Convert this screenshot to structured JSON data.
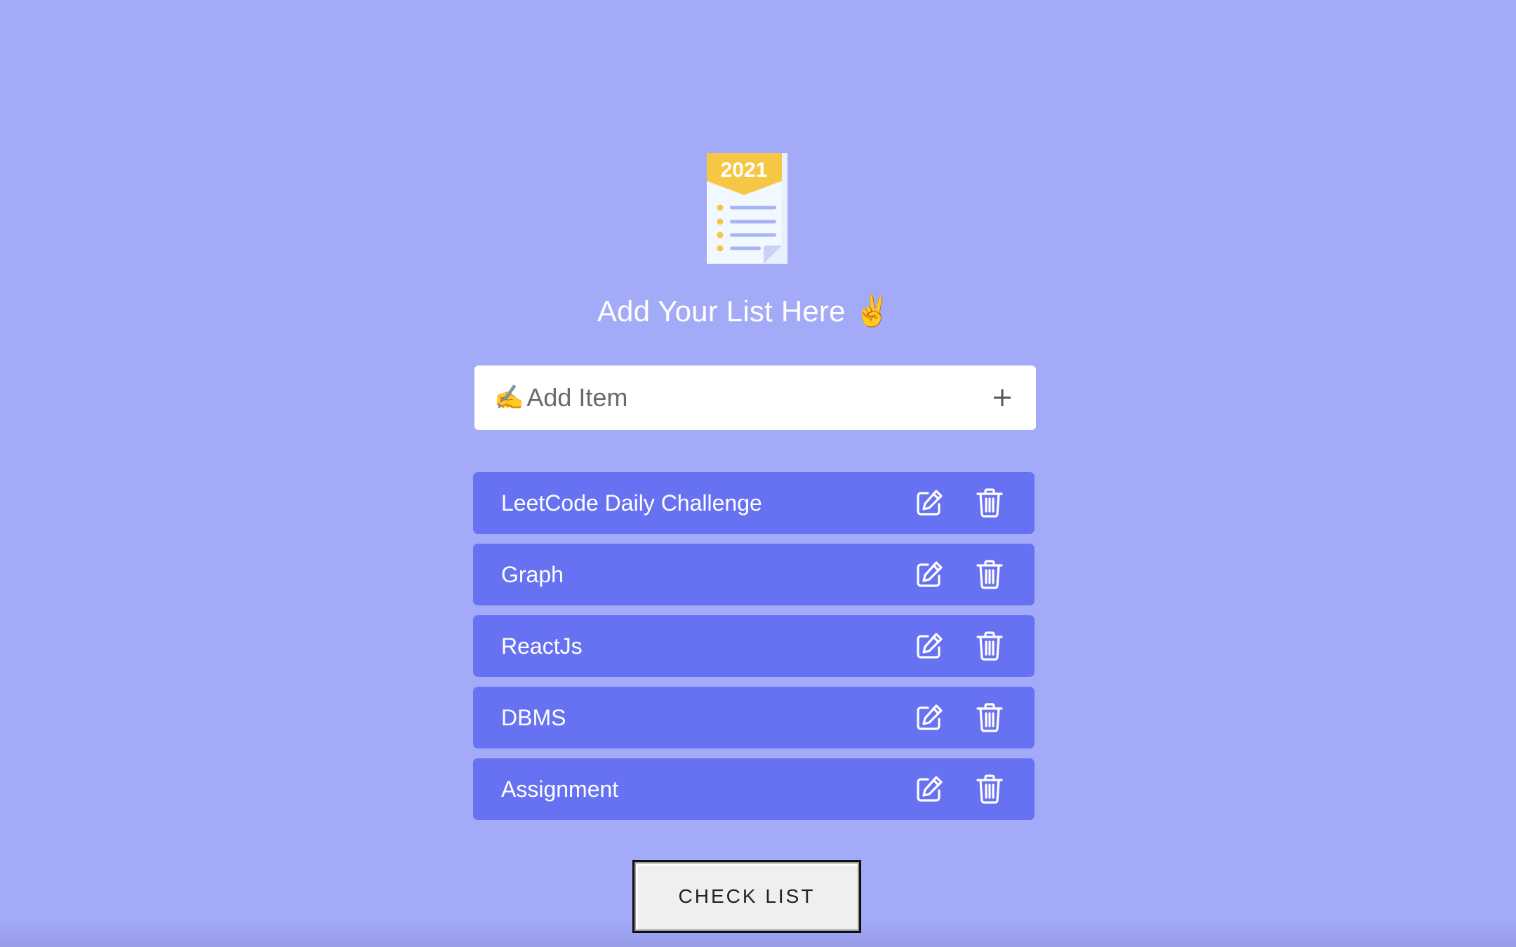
{
  "logo": {
    "year": "2021",
    "icon": "checklist-document-icon"
  },
  "heading": {
    "text": "Add Your List Here",
    "emoji": "✌️"
  },
  "add_item": {
    "pen_emoji": "✍️",
    "placeholder": "Add Item",
    "value": "",
    "add_icon": "plus-icon"
  },
  "list": {
    "items": [
      {
        "label": "LeetCode Daily Challenge"
      },
      {
        "label": "Graph"
      },
      {
        "label": "ReactJs"
      },
      {
        "label": "DBMS"
      },
      {
        "label": "Assignment"
      }
    ],
    "edit_icon": "edit-icon",
    "delete_icon": "trash-icon"
  },
  "check_list_button": {
    "label": "CHECK LIST"
  },
  "colors": {
    "background": "#a3aaf8",
    "item_background": "#6772f3",
    "accent_yellow": "#f6c744"
  }
}
